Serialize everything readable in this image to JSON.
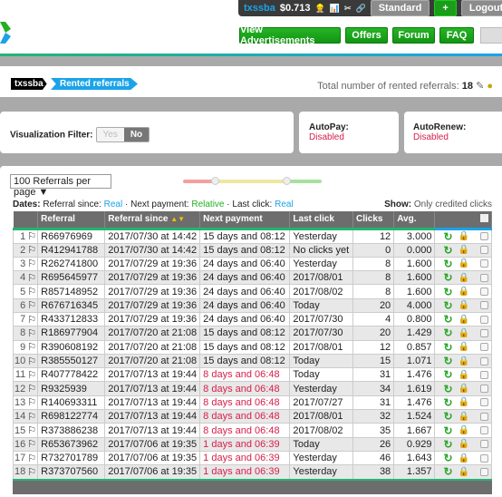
{
  "topbar": {
    "username": "txssba",
    "balance": "$0.713",
    "membership": "Standard",
    "plus": "+",
    "logout": "Logout"
  },
  "nav": [
    "View Advertisements",
    "Offers",
    "Forum",
    "FAQ"
  ],
  "breadcrumb": [
    "txssba",
    "Rented referrals"
  ],
  "total": {
    "label": "Total number of rented referrals:",
    "value": "18"
  },
  "filter": {
    "label": "Visualization Filter:",
    "yes": "Yes",
    "no": "No",
    "selected": "No"
  },
  "autopay": {
    "label": "AutoPay:",
    "value": "Disabled"
  },
  "autorenew": {
    "label": "AutoRenew:",
    "value": "Disabled"
  },
  "perpage": "100 Referrals per page ▼",
  "dates": {
    "label": "Dates:",
    "since_label": "Referral since:",
    "since_val": "Real",
    "next_label": "Next payment:",
    "next_val": "Relative",
    "last_label": "Last click:",
    "last_val": "Real",
    "sep": "·"
  },
  "show": {
    "label": "Show:",
    "value": "Only credited clicks"
  },
  "columns": [
    "",
    "Referral",
    "Referral since",
    "Next payment",
    "Last click",
    "Clicks",
    "Avg.",
    ""
  ],
  "colors": {
    "accent": "#1aa3e8",
    "green": "#129612",
    "red": "#d6204a"
  },
  "rows": [
    [
      "1",
      "R66976969",
      "2017/07/30 at 14:42",
      "15 days and 08:12",
      "Yesterday",
      "12",
      "3.000"
    ],
    [
      "2",
      "R412941788",
      "2017/07/30 at 14:42",
      "15 days and 08:12",
      "No clicks yet",
      "0",
      "0.000"
    ],
    [
      "3",
      "R262741800",
      "2017/07/29 at 19:36",
      "24 days and 06:40",
      "Yesterday",
      "8",
      "1.600"
    ],
    [
      "4",
      "R695645977",
      "2017/07/29 at 19:36",
      "24 days and 06:40",
      "2017/08/01",
      "8",
      "1.600"
    ],
    [
      "5",
      "R857148952",
      "2017/07/29 at 19:36",
      "24 days and 06:40",
      "2017/08/02",
      "8",
      "1.600"
    ],
    [
      "6",
      "R676716345",
      "2017/07/29 at 19:36",
      "24 days and 06:40",
      "Today",
      "20",
      "4.000"
    ],
    [
      "7",
      "R433712833",
      "2017/07/29 at 19:36",
      "24 days and 06:40",
      "2017/07/30",
      "4",
      "0.800"
    ],
    [
      "8",
      "R186977904",
      "2017/07/20 at 21:08",
      "15 days and 08:12",
      "2017/07/30",
      "20",
      "1.429"
    ],
    [
      "9",
      "R390608192",
      "2017/07/20 at 21:08",
      "15 days and 08:12",
      "2017/08/01",
      "12",
      "0.857"
    ],
    [
      "10",
      "R385550127",
      "2017/07/20 at 21:08",
      "15 days and 08:12",
      "Today",
      "15",
      "1.071"
    ],
    [
      "11",
      "R407778422",
      "2017/07/13 at 19:44",
      "8 days and 06:48",
      "Today",
      "31",
      "1.476"
    ],
    [
      "12",
      "R9325939",
      "2017/07/13 at 19:44",
      "8 days and 06:48",
      "Yesterday",
      "34",
      "1.619"
    ],
    [
      "13",
      "R140693311",
      "2017/07/13 at 19:44",
      "8 days and 06:48",
      "2017/07/27",
      "31",
      "1.476"
    ],
    [
      "14",
      "R698122774",
      "2017/07/13 at 19:44",
      "8 days and 06:48",
      "2017/08/01",
      "32",
      "1.524"
    ],
    [
      "15",
      "R373886238",
      "2017/07/13 at 19:44",
      "8 days and 06:48",
      "2017/08/02",
      "35",
      "1.667"
    ],
    [
      "16",
      "R653673962",
      "2017/07/06 at 19:35",
      "1 days and 06:39",
      "Today",
      "26",
      "0.929"
    ],
    [
      "17",
      "R732701789",
      "2017/07/06 at 19:35",
      "1 days and 06:39",
      "Yesterday",
      "46",
      "1.643"
    ],
    [
      "18",
      "R373707560",
      "2017/07/06 at 19:35",
      "1 days and 06:39",
      "Yesterday",
      "38",
      "1.357"
    ]
  ],
  "urgent_rows_from": 11
}
